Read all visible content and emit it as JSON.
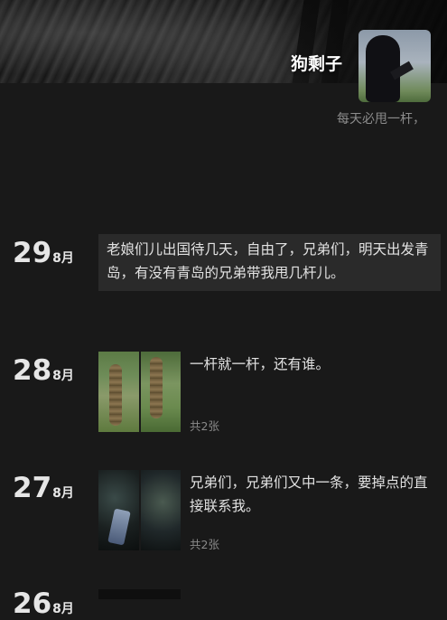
{
  "profile": {
    "nickname": "狗剩子",
    "signature": "每天必甩一杆，"
  },
  "posts": [
    {
      "day": "29",
      "month": "8月",
      "text": "老娘们儿出国待几天，自由了，兄弟们，明天出发青岛，有没有青岛的兄弟带我甩几杆儿。"
    },
    {
      "day": "28",
      "month": "8月",
      "text": "一杆就一杆，还有谁。",
      "count": "共2张"
    },
    {
      "day": "27",
      "month": "8月",
      "text": "兄弟们，兄弟们又中一条，要掉点的直接联系我。",
      "count": "共2张"
    },
    {
      "day": "26",
      "month": "8月"
    }
  ]
}
